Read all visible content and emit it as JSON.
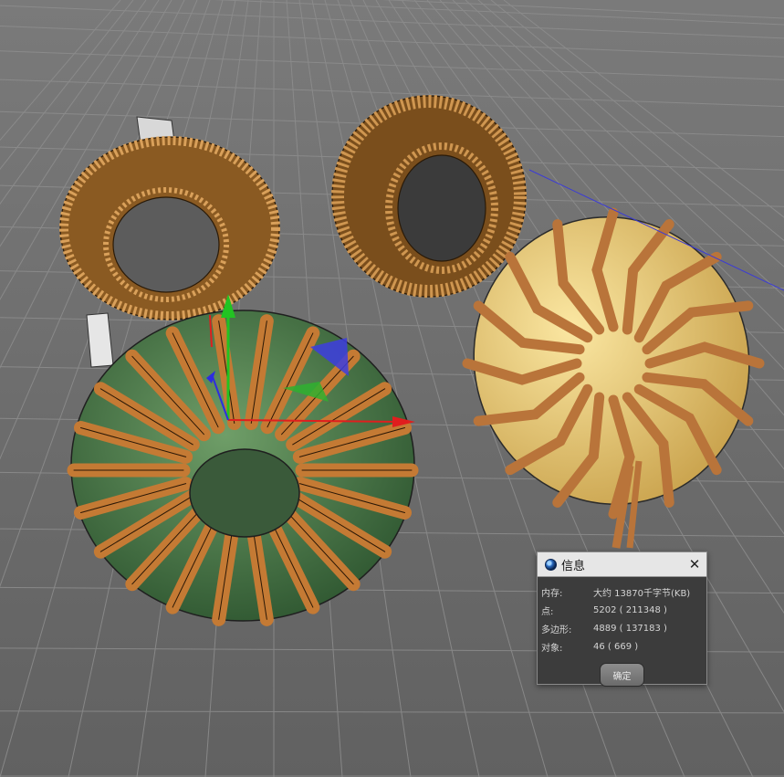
{
  "dialog": {
    "title": "信息",
    "close_glyph": "✕",
    "ok_label": "确定",
    "rows": [
      {
        "label": "内存:",
        "value": "大约 13870千字节(KB)"
      },
      {
        "label": "点:",
        "value": "5202 ( 211348 )"
      },
      {
        "label": "多边形:",
        "value": "4889 ( 137183 )"
      },
      {
        "label": "对象:",
        "value": "46 ( 669 )"
      }
    ]
  },
  "viewport": {
    "background_color": "#6b6b6b",
    "grid_color": "#8c8c8c",
    "wire_copper": "#b87333",
    "core_green": "#3d6b3e",
    "core_yellow": "#e6c66a",
    "core_tan": "#d2a85a",
    "axis_colors": {
      "x": "#e01e1e",
      "y": "#22c322",
      "z": "#2d2de0"
    }
  },
  "icons": {
    "app": "cinema4d-app-icon",
    "close": "close-icon"
  }
}
